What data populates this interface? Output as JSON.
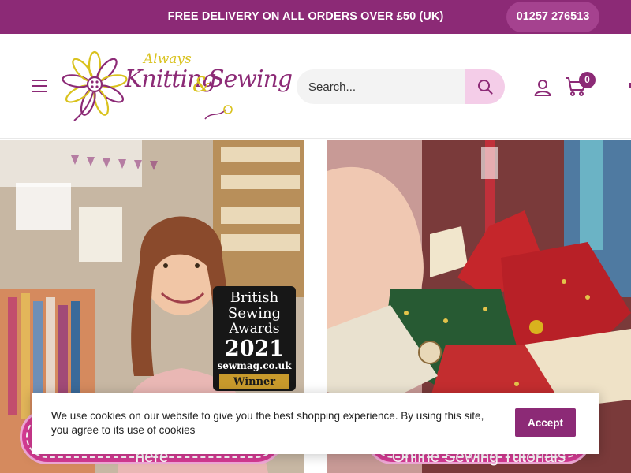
{
  "announcement": {
    "text": "FREE DELIVERY ON ALL ORDERS OVER £50 (UK)",
    "phone": "01257 276513"
  },
  "logo": {
    "line1": "Always",
    "word1": "Knitting",
    "amp": "&",
    "word2": "Sewing"
  },
  "search": {
    "placeholder": "Search..."
  },
  "cart": {
    "count": "0"
  },
  "banners": {
    "left": {
      "award": {
        "line1": "British",
        "line2": "Sewing",
        "line3": "Awards",
        "year": "2021",
        "site": "sewmag.co.uk",
        "winner": "Winner"
      },
      "cta": "here"
    },
    "right": {
      "cta": "Online Sewing Tutorials"
    }
  },
  "cookie": {
    "text": "We use cookies on our website to give you the best shopping experience. By using this site, you agree to its use of cookies",
    "accept": "Accept"
  },
  "colors": {
    "brand": "#8c2a76",
    "cta_pink": "#d63b94",
    "logo_yellow": "#d9c21e"
  }
}
